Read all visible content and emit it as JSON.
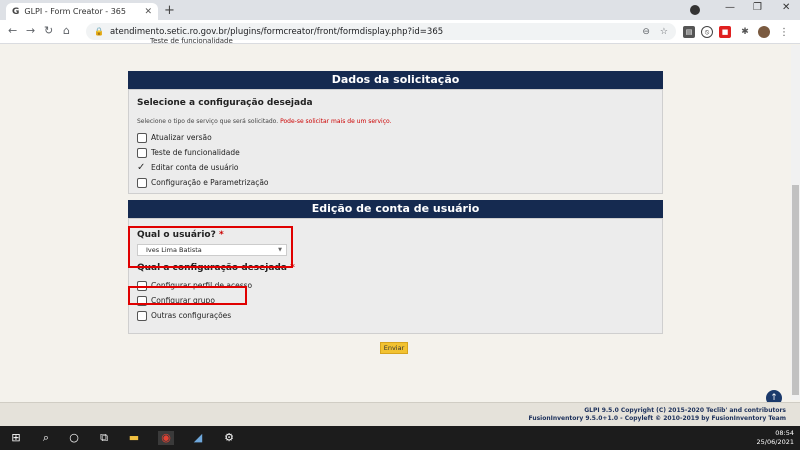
{
  "browser": {
    "tab_favicon": "G",
    "tab_title": "GLPI - Form Creator - 365",
    "tab_close": "✕",
    "new_tab": "+",
    "url": "atendimento.setic.ro.gov.br/plugins/formcreator/front/formdisplay.php?id=365",
    "icons": [
      "back-icon",
      "forward-icon",
      "reload-icon",
      "home-icon",
      "lock-icon",
      "zoom-icon",
      "star-icon"
    ]
  },
  "form": {
    "prev_item": "Teste de funcionalidade",
    "section1": {
      "header": "Dados da solicitação",
      "question": "Selecione a configuração desejada",
      "help": "Selecione o tipo de serviço que será solicitado.",
      "help_red": "Pode-se solicitar mais de um serviço.",
      "options": [
        {
          "label": "Atualizar versão",
          "checked": false
        },
        {
          "label": "Teste de funcionalidade",
          "checked": false
        },
        {
          "label": "Editar conta de usuário",
          "checked": true
        },
        {
          "label": "Configuração e Parametrização",
          "checked": false
        }
      ]
    },
    "section2": {
      "header": "Edição de conta de usuário",
      "user_question": "Qual o usuário?",
      "required_mark": "*",
      "user_value": "Ives Lima Batista",
      "config_question": "Qual a configuração desejada",
      "options": [
        {
          "label": "Configurar perfil de acesso",
          "checked": false
        },
        {
          "label": "Configurar grupo",
          "checked": false
        },
        {
          "label": "Outras configurações",
          "checked": false
        }
      ]
    },
    "submit_label": "Enviar"
  },
  "footer": {
    "line1": "GLPI 9.5.0 Copyright (C) 2015-2020 Teclib' and contributors",
    "line2": "FusionInventory 9.5.0+1.0 - Copyleft © 2010-2019 by FusionInventory Team"
  },
  "taskbar": {
    "time": "08:54",
    "date": "25/06/2021"
  },
  "colors": {
    "section_header": "#152a50",
    "highlight": "#e00000",
    "submit": "#f2c230"
  }
}
